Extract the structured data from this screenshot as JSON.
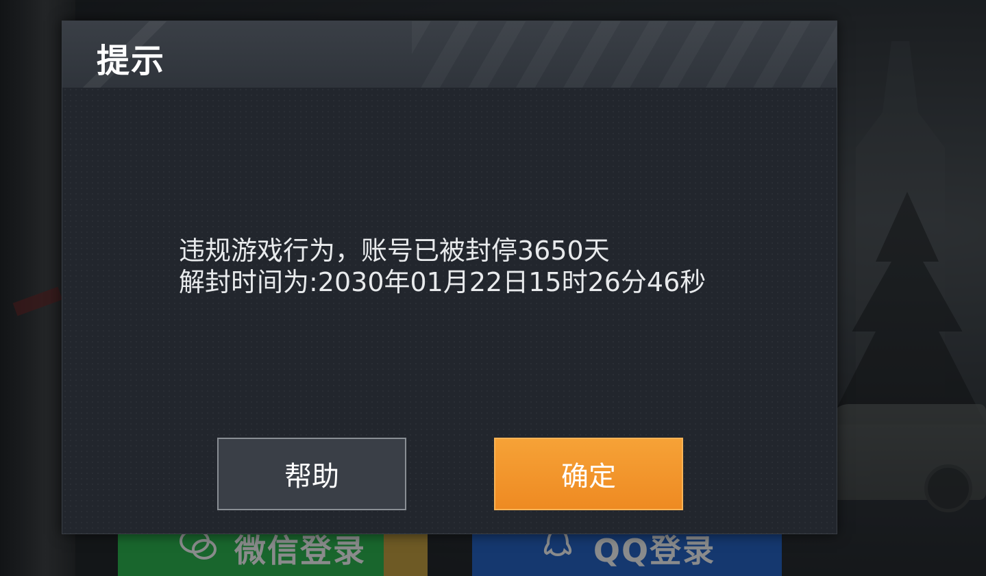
{
  "dialog": {
    "title": "提示",
    "message_line1": "违规游戏行为，账号已被封停3650天",
    "message_line2": "解封时间为:2030年01月22日15时26分46秒",
    "help_button": "帮助",
    "confirm_button": "确定"
  },
  "background_login": {
    "wechat_label": "微信登录",
    "qq_label": "QQ登录"
  },
  "colors": {
    "confirm_button": "#f0902a",
    "help_button": "#3a3f47",
    "wechat_bar": "#27b84a",
    "qq_bar": "#1f61c8",
    "dialog_bg": "#22262d"
  },
  "icons": {
    "wechat": "wechat-icon",
    "qq": "qq-penguin-icon"
  }
}
